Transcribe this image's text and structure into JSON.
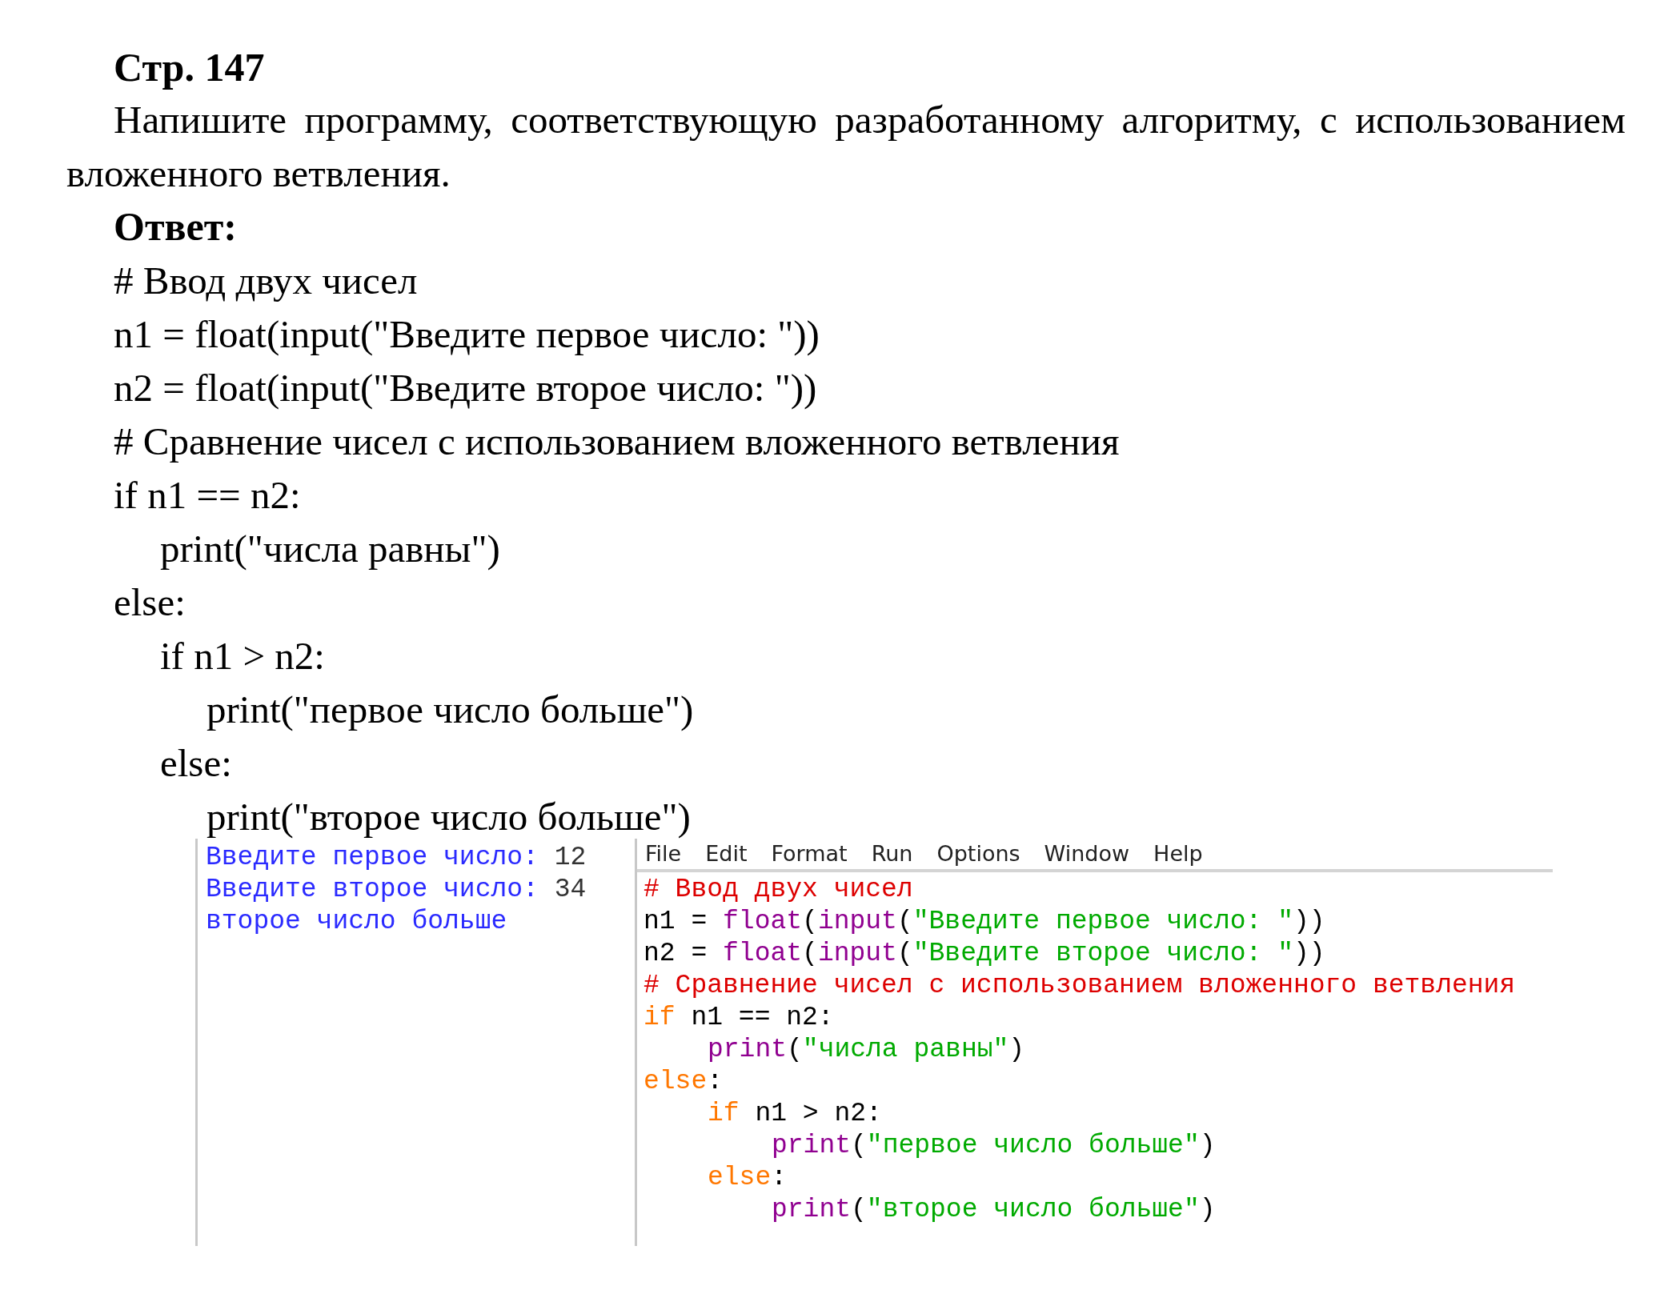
{
  "page_heading": "Стр. 147",
  "task": "Напишите программу, соответствующую разработанному алгоритму, с использованием вложенного ветвления.",
  "answer_label": "Ответ:",
  "answer_code": [
    {
      "text": "# Ввод двух чисел"
    },
    {
      "text": "n1 = float(input(\"Введите первое число: \"))"
    },
    {
      "text": "n2 = float(input(\"Введите второе число: \"))"
    },
    {
      "text": "# Сравнение чисел с использованием вложенного ветвления"
    },
    {
      "text": "if n1 == n2:",
      "children": [
        {
          "text": "print(\"числа равны\")"
        }
      ]
    },
    {
      "text": "else:",
      "children": [
        {
          "text": "if n1 > n2:",
          "children": [
            {
              "text": "print(\"первое число больше\")"
            }
          ]
        },
        {
          "text": "else:",
          "children": [
            {
              "text": "print(\"второе число больше\")"
            }
          ]
        }
      ]
    }
  ],
  "shell": {
    "lines": [
      {
        "output": "Введите первое число: ",
        "input": "12"
      },
      {
        "output": "Введите второе число: ",
        "input": "34"
      },
      {
        "output": "второе число больше"
      }
    ]
  },
  "editor": {
    "menu": [
      "File",
      "Edit",
      "Format",
      "Run",
      "Options",
      "Window",
      "Help"
    ],
    "lines": [
      {
        "tokens": [
          {
            "kind": "comment",
            "text": "# Ввод двух чисел"
          }
        ]
      },
      {
        "tokens": [
          {
            "kind": "plain",
            "text": "n1 = "
          },
          {
            "kind": "builtin",
            "text": "float"
          },
          {
            "kind": "plain",
            "text": "("
          },
          {
            "kind": "builtin",
            "text": "input"
          },
          {
            "kind": "plain",
            "text": "("
          },
          {
            "kind": "string",
            "text": "\"Введите первое число: \""
          },
          {
            "kind": "plain",
            "text": "))"
          }
        ]
      },
      {
        "tokens": [
          {
            "kind": "plain",
            "text": "n2 = "
          },
          {
            "kind": "builtin",
            "text": "float"
          },
          {
            "kind": "plain",
            "text": "("
          },
          {
            "kind": "builtin",
            "text": "input"
          },
          {
            "kind": "plain",
            "text": "("
          },
          {
            "kind": "string",
            "text": "\"Введите второе число: \""
          },
          {
            "kind": "plain",
            "text": "))"
          }
        ]
      },
      {
        "tokens": [
          {
            "kind": "comment",
            "text": "# Сравнение чисел с использованием вложенного ветвления"
          }
        ]
      },
      {
        "tokens": [
          {
            "kind": "keyword",
            "text": "if"
          },
          {
            "kind": "plain",
            "text": " n1 == n2:"
          }
        ],
        "children": [
          {
            "tokens": [
              {
                "kind": "builtin",
                "text": "print"
              },
              {
                "kind": "plain",
                "text": "("
              },
              {
                "kind": "string",
                "text": "\"числа равны\""
              },
              {
                "kind": "plain",
                "text": ")"
              }
            ]
          }
        ]
      },
      {
        "tokens": [
          {
            "kind": "keyword",
            "text": "else"
          },
          {
            "kind": "plain",
            "text": ":"
          }
        ],
        "children": [
          {
            "tokens": [
              {
                "kind": "keyword",
                "text": "if"
              },
              {
                "kind": "plain",
                "text": " n1 > n2:"
              }
            ],
            "children": [
              {
                "tokens": [
                  {
                    "kind": "builtin",
                    "text": "print"
                  },
                  {
                    "kind": "plain",
                    "text": "("
                  },
                  {
                    "kind": "string",
                    "text": "\"первое число больше\""
                  },
                  {
                    "kind": "plain",
                    "text": ")"
                  }
                ]
              }
            ]
          },
          {
            "tokens": [
              {
                "kind": "keyword",
                "text": "else"
              },
              {
                "kind": "plain",
                "text": ":"
              }
            ],
            "children": [
              {
                "tokens": [
                  {
                    "kind": "builtin",
                    "text": "print"
                  },
                  {
                    "kind": "plain",
                    "text": "("
                  },
                  {
                    "kind": "string",
                    "text": "\"второе число больше\""
                  },
                  {
                    "kind": "plain",
                    "text": ")"
                  }
                ]
              }
            ]
          }
        ]
      }
    ]
  }
}
